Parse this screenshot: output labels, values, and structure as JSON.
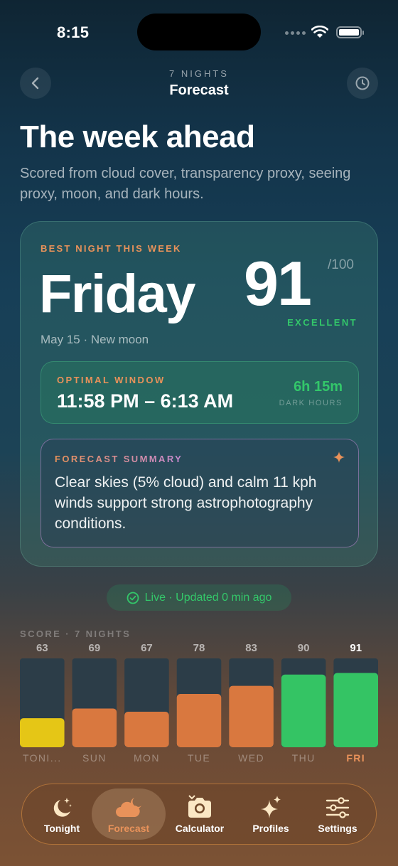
{
  "status_bar": {
    "time": "8:15"
  },
  "nav": {
    "subtitle": "7 NIGHTS",
    "title": "Forecast"
  },
  "header": {
    "title": "The week ahead",
    "description": "Scored from cloud cover, transparency proxy, seeing proxy, moon, and dark hours."
  },
  "best_night": {
    "label": "BEST NIGHT THIS WEEK",
    "day": "Friday",
    "score": "91",
    "score_max": "/100",
    "rating": "EXCELLENT",
    "date": "May 15 · New moon",
    "window_label": "OPTIMAL WINDOW",
    "window_time": "11:58 PM – 6:13 AM",
    "dark_hours": "6h 15m",
    "dark_hours_label": "DARK HOURS",
    "summary_label": "FORECAST SUMMARY",
    "summary_text": "Clear skies (5% cloud) and calm 11 kph winds support strong astrophotography conditions."
  },
  "live": {
    "text": "Live · Updated 0 min ago"
  },
  "chart_data": {
    "type": "bar",
    "title": "SCORE · 7 NIGHTS",
    "categories": [
      "TONI...",
      "SUN",
      "MON",
      "TUE",
      "WED",
      "THU",
      "FRI"
    ],
    "values": [
      63,
      69,
      67,
      78,
      83,
      90,
      91
    ],
    "ylim": [
      0,
      100
    ],
    "highlight_index": 6,
    "colors": [
      "#e5c616",
      "#d9783f",
      "#d9783f",
      "#d9783f",
      "#d9783f",
      "#34c464",
      "#34c464"
    ],
    "track_color": "#2c3d48",
    "highlight_label_color": "#e9925a"
  },
  "tabs": [
    {
      "label": "Tonight",
      "icon": "moon-stars-icon"
    },
    {
      "label": "Forecast",
      "icon": "cloud-moon-icon",
      "active": true
    },
    {
      "label": "Calculator",
      "icon": "camera-icon"
    },
    {
      "label": "Profiles",
      "icon": "sparkles-icon"
    },
    {
      "label": "Settings",
      "icon": "sliders-icon"
    }
  ],
  "colors": {
    "accent": "#e9925a",
    "good": "#33c76a"
  }
}
